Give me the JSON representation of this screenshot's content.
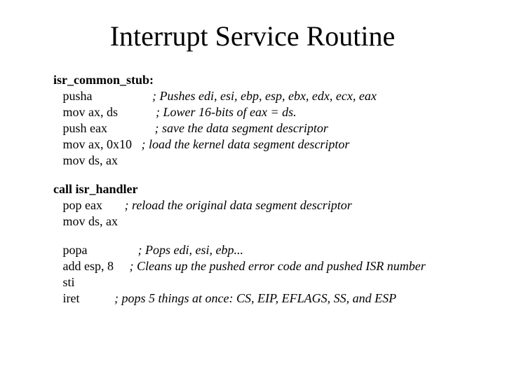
{
  "title": "Interrupt Service Routine",
  "block1": {
    "label": "isr_common_stub:",
    "lines": [
      {
        "instr": "   pusha                   ",
        "comment": "; Pushes edi, esi, ebp, esp, ebx, edx, ecx, eax"
      },
      {
        "instr": "   mov ax, ds            ",
        "comment": "; Lower 16-bits of eax = ds."
      },
      {
        "instr": "   push eax               ",
        "comment": "; save the data segment descriptor"
      },
      {
        "instr": "   mov ax, 0x10   ",
        "comment": "; load the kernel data segment descriptor"
      },
      {
        "instr": "   mov ds, ax",
        "comment": ""
      }
    ]
  },
  "block2": {
    "label": "   call isr_handler",
    "lines": [
      {
        "instr": "   pop eax       ",
        "comment": "; reload the original data segment descriptor"
      },
      {
        "instr": "   mov ds, ax",
        "comment": ""
      }
    ]
  },
  "block3": {
    "lines": [
      {
        "instr": "   popa                ",
        "comment": "; Pops edi, esi, ebp..."
      },
      {
        "instr": "   add esp, 8     ",
        "comment": "; Cleans up the pushed error code and pushed ISR number"
      },
      {
        "instr": "   sti",
        "comment": ""
      },
      {
        "instr": "   iret           ",
        "comment": "; pops 5 things at once: CS, EIP, EFLAGS, SS, and ESP"
      }
    ]
  }
}
